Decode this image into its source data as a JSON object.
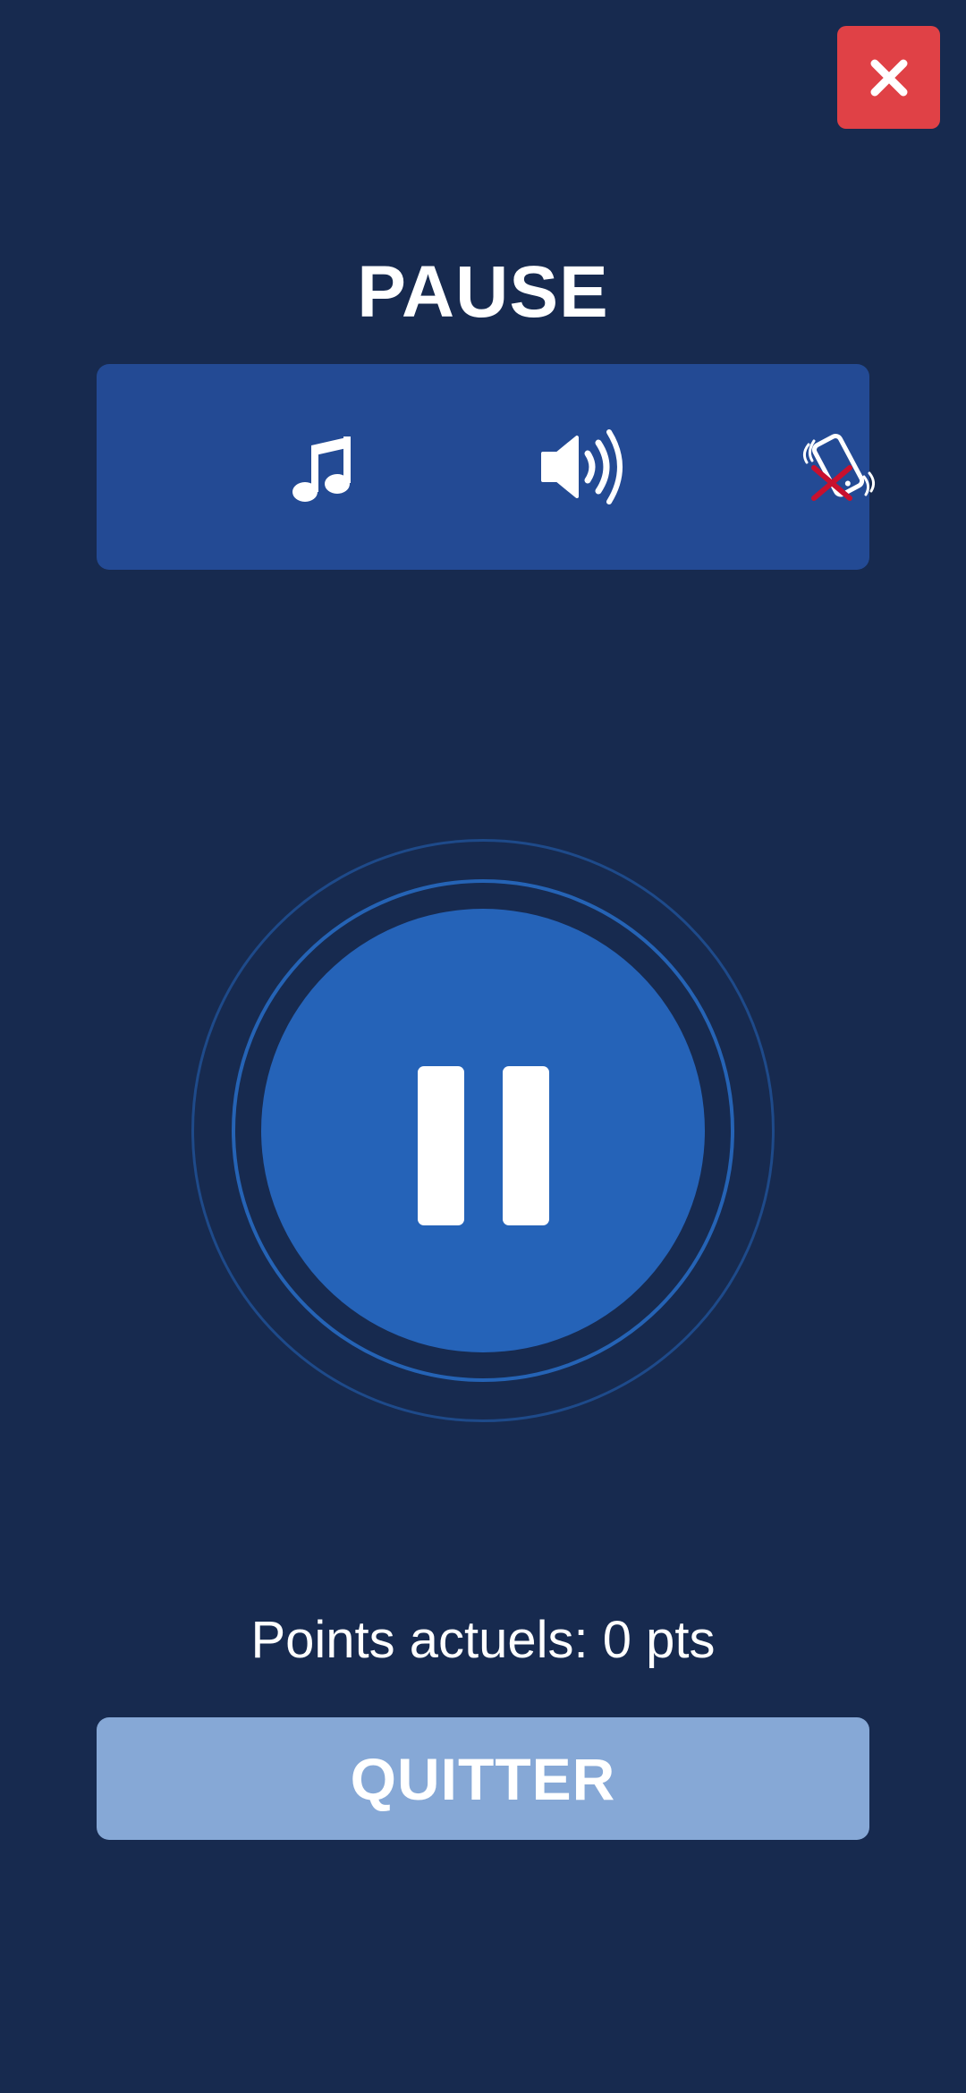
{
  "header": {
    "close_icon": "close-icon"
  },
  "pause_screen": {
    "title": "PAUSE"
  },
  "settings": {
    "items": [
      {
        "name": "music",
        "icon": "music-note-icon",
        "enabled": true
      },
      {
        "name": "sound",
        "icon": "speaker-volume-icon",
        "enabled": true
      },
      {
        "name": "vibration",
        "icon": "phone-vibration-icon",
        "enabled": false
      }
    ]
  },
  "pause_button": {
    "icon": "pause-icon"
  },
  "score": {
    "text": "Points actuels: 0 pts"
  },
  "actions": {
    "quit_label": "QUITTER"
  },
  "colors": {
    "background": "#172a4f",
    "panel": "#234a94",
    "close": "#e04146",
    "pause_button": "#2563b8",
    "quit_button": "#86a8d6",
    "disabled_mark": "#c8102e"
  }
}
